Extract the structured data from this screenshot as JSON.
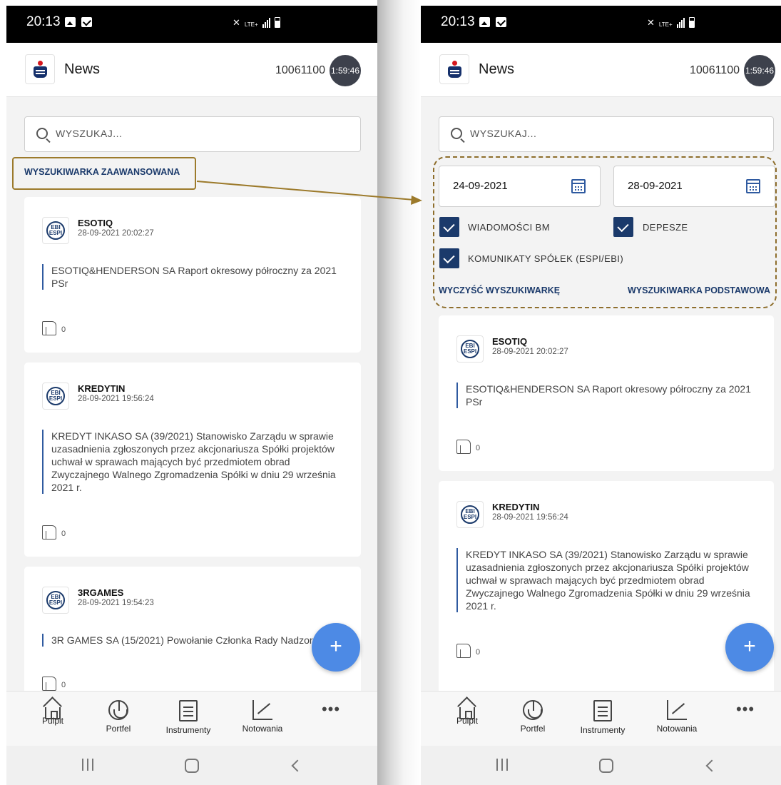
{
  "status_bar": {
    "time": "20:13",
    "network": "LTE+"
  },
  "app_bar": {
    "title": "News",
    "account": "10061100",
    "session_timer": "1:59:46"
  },
  "search": {
    "placeholder": "WYSZUKAJ..."
  },
  "links": {
    "advanced_search": "WYSZUKIWARKA ZAAWANSOWANA",
    "clear_search": "WYCZYŚĆ WYSZUKIWARKĘ",
    "basic_search": "WYSZUKIWARKA PODSTAWOWA"
  },
  "filters": {
    "date_from": "24-09-2021",
    "date_to": "28-09-2021",
    "checkboxes": [
      {
        "label": "WIADOMOŚCI BM",
        "checked": true
      },
      {
        "label": "DEPESZE",
        "checked": true
      },
      {
        "label": "KOMUNIKATY SPÓŁEK (ESPI/EBI)",
        "checked": true
      }
    ]
  },
  "news": [
    {
      "source_badge": [
        "EBI",
        "ESPI"
      ],
      "company": "ESOTIQ",
      "datetime": "28-09-2021 20:02:27",
      "text": "ESOTIQ&HENDERSON SA Raport okresowy półroczny za 2021 PSr",
      "likes": "0"
    },
    {
      "source_badge": [
        "EBI",
        "ESPI"
      ],
      "company": "KREDYTIN",
      "datetime": "28-09-2021 19:56:24",
      "text": "KREDYT INKASO SA (39/2021) Stanowisko Zarządu w sprawie uzasadnienia zgłoszonych przez akcjonariusza Spółki projektów uchwał w sprawach mających być przedmiotem obrad Zwyczajnego Walnego Zgromadzenia Spółki w dniu 29 września 2021 r.",
      "likes": "0"
    },
    {
      "source_badge": [
        "EBI",
        "ESPI"
      ],
      "company": "3RGAMES",
      "datetime": "28-09-2021 19:54:23",
      "text": "3R GAMES SA (15/2021) Powołanie Członka Rady Nadzorczej",
      "likes": "0"
    }
  ],
  "fab": {
    "icon": "+"
  },
  "bottom_nav": [
    {
      "label": "Pulpit",
      "icon": "home-icon"
    },
    {
      "label": "Portfel",
      "icon": "pie-chart-icon"
    },
    {
      "label": "Instrumenty",
      "icon": "list-icon"
    },
    {
      "label": "Notowania",
      "icon": "line-chart-icon"
    },
    {
      "label": "",
      "icon": "more-icon"
    }
  ],
  "colors": {
    "accent": "#1b3a6b",
    "fab": "#4d8ae5",
    "annotation": "#9c7a2b"
  }
}
